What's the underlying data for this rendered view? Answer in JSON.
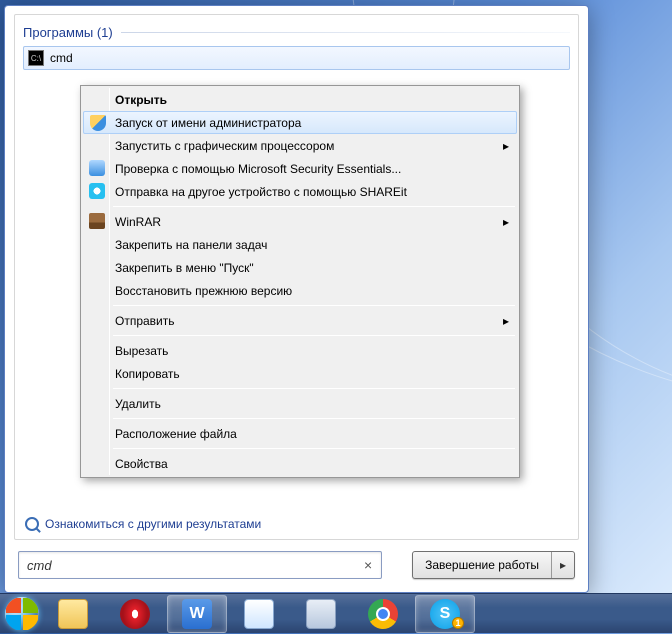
{
  "startmenu": {
    "section_header": "Программы (1)",
    "result": {
      "label": "cmd"
    },
    "see_more": "Ознакомиться с другими результатами",
    "search_value": "cmd",
    "shutdown_label": "Завершение работы"
  },
  "context_menu": {
    "items": [
      {
        "label": "Открыть",
        "default": true
      },
      {
        "label": "Запуск от имени администратора",
        "icon": "shield",
        "hover": true
      },
      {
        "label": "Запустить с графическим процессором",
        "submenu": true
      },
      {
        "label": "Проверка с помощью Microsoft Security Essentials...",
        "icon": "mse"
      },
      {
        "label": "Отправка на другое устройство с помощью SHAREit",
        "icon": "shareit"
      },
      {
        "sep": true
      },
      {
        "label": "WinRAR",
        "icon": "winrar",
        "submenu": true
      },
      {
        "label": "Закрепить на панели задач"
      },
      {
        "label": "Закрепить в меню \"Пуск\""
      },
      {
        "label": "Восстановить прежнюю версию"
      },
      {
        "sep": true
      },
      {
        "label": "Отправить",
        "submenu": true
      },
      {
        "sep": true
      },
      {
        "label": "Вырезать"
      },
      {
        "label": "Копировать"
      },
      {
        "sep": true
      },
      {
        "label": "Удалить"
      },
      {
        "sep": true
      },
      {
        "label": "Расположение файла"
      },
      {
        "sep": true
      },
      {
        "label": "Свойства"
      }
    ]
  },
  "taskbar": {
    "badge": "1"
  }
}
